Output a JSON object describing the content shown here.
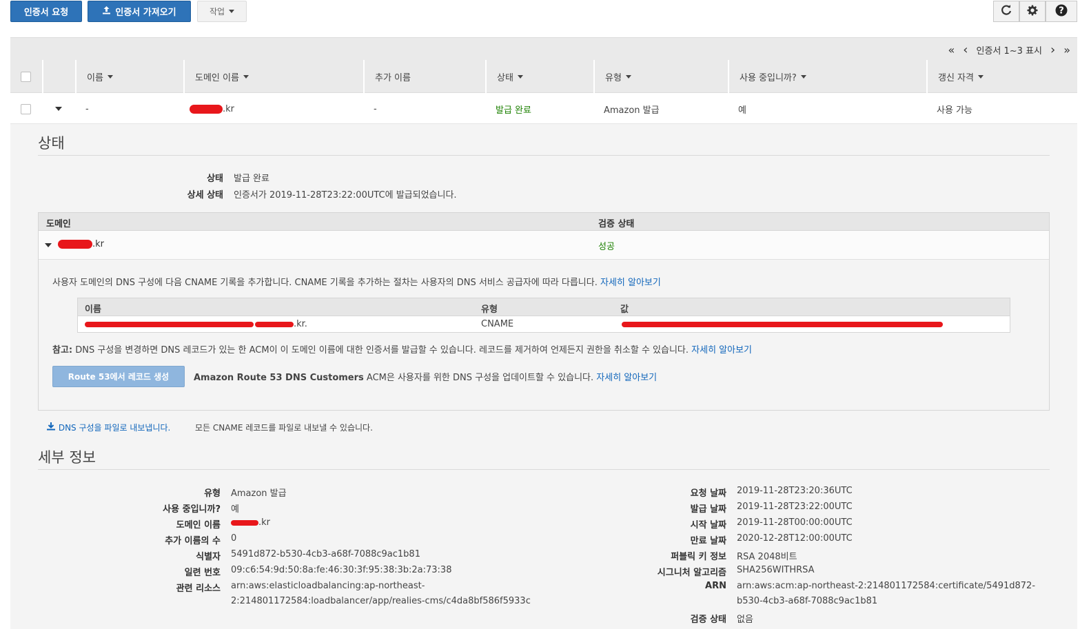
{
  "toolbar": {
    "request_cert": "인증서 요청",
    "import_cert": "인증서 가져오기",
    "actions": "작업",
    "refresh_icon": "refresh-icon",
    "settings_icon": "gear-icon",
    "help_icon": "help-icon"
  },
  "pager": {
    "first": "«",
    "prev": "‹",
    "text": "인증서 1~3 표시",
    "next": "›",
    "last": "»"
  },
  "table": {
    "columns": [
      "이름",
      "도메인 이름",
      "추가 이름",
      "상태",
      "유형",
      "사용 중입니까?",
      "갱신 자격"
    ],
    "row": {
      "name": "-",
      "domain_suffix": ".kr",
      "additional": "-",
      "status": "발급 완료",
      "type": "Amazon 발급",
      "in_use": "예",
      "renewal": "사용 가능"
    }
  },
  "status_section": {
    "title": "상태",
    "status_label": "상태",
    "status_value": "발급 완료",
    "detail_label": "상세 상태",
    "detail_value": "인증서가 2019-11-28T23:22:00UTC에 발급되었습니다."
  },
  "domain_table": {
    "col_domain": "도메인",
    "col_validation": "검증 상태",
    "domain_suffix": ".kr",
    "validation": "성공",
    "instruction": "사용자 도메인의 DNS 구성에 다음 CNAME 기록을 추가합니다. CNAME 기록을 추가하는 절차는 사용자의 DNS 서비스 공급자에 따라 다릅니다.",
    "learn_more": "자세히 알아보기",
    "cname": {
      "col_name": "이름",
      "col_type": "유형",
      "col_value": "값",
      "name_suffix": ".kr.",
      "type": "CNAME"
    },
    "note_label": "참고:",
    "note_text": "DNS 구성을 변경하면 DNS 레코드가 있는 한 ACM이 이 도메인 이름에 대한 인증서를 발급할 수 있습니다. 레코드를 제거하여 언제든지 권한을 취소할 수 있습니다.",
    "note_link": "자세히 알아보기",
    "r53_button": "Route 53에서 레코드 생성",
    "r53_bold": "Amazon Route 53 DNS Customers",
    "r53_text": "ACM은 사용자를 위한 DNS 구성을 업데이트할 수 있습니다.",
    "r53_link": "자세히 알아보기"
  },
  "export": {
    "link": "DNS 구성을 파일로 내보냅니다.",
    "desc": "모든 CNAME 레코드를 파일로 내보낼 수 있습니다."
  },
  "details": {
    "title": "세부 정보",
    "left": [
      {
        "label": "유형",
        "value": "Amazon 발급"
      },
      {
        "label": "사용 중입니까?",
        "value": "예"
      },
      {
        "label": "도메인 이름",
        "value": ".kr"
      },
      {
        "label": "추가 이름의 수",
        "value": "0"
      },
      {
        "label": "식별자",
        "value": "5491d872-b530-4cb3-a68f-7088c9ac1b81"
      },
      {
        "label": "일련 번호",
        "value": "09:c6:54:9d:50:8a:fe:46:30:3f:95:38:3b:2a:73:38"
      },
      {
        "label": "관련 리소스",
        "value": "arn:aws:elasticloadbalancing:ap-northeast-",
        "value2": "2:214801172584:loadbalancer/app/realies-cms/c4da8bf586f5933c"
      }
    ],
    "right": [
      {
        "label": "요청 날짜",
        "value": "2019-11-28T23:20:36UTC"
      },
      {
        "label": "발급 날짜",
        "value": "2019-11-28T23:22:00UTC"
      },
      {
        "label": "시작 날짜",
        "value": "2019-11-28T00:00:00UTC"
      },
      {
        "label": "만료 날짜",
        "value": "2020-12-28T12:00:00UTC"
      },
      {
        "label": "퍼블릭 키 정보",
        "value": "RSA 2048비트"
      },
      {
        "label": "시그니처 알고리즘",
        "value": "SHA256WITHRSA"
      },
      {
        "label": "ARN",
        "value": "arn:aws:acm:ap-northeast-2:214801172584:certificate/5491d872-",
        "value2": "b530-4cb3-a68f-7088c9ac1b81"
      },
      {
        "label": "검증 상태",
        "value": "없음"
      }
    ]
  }
}
